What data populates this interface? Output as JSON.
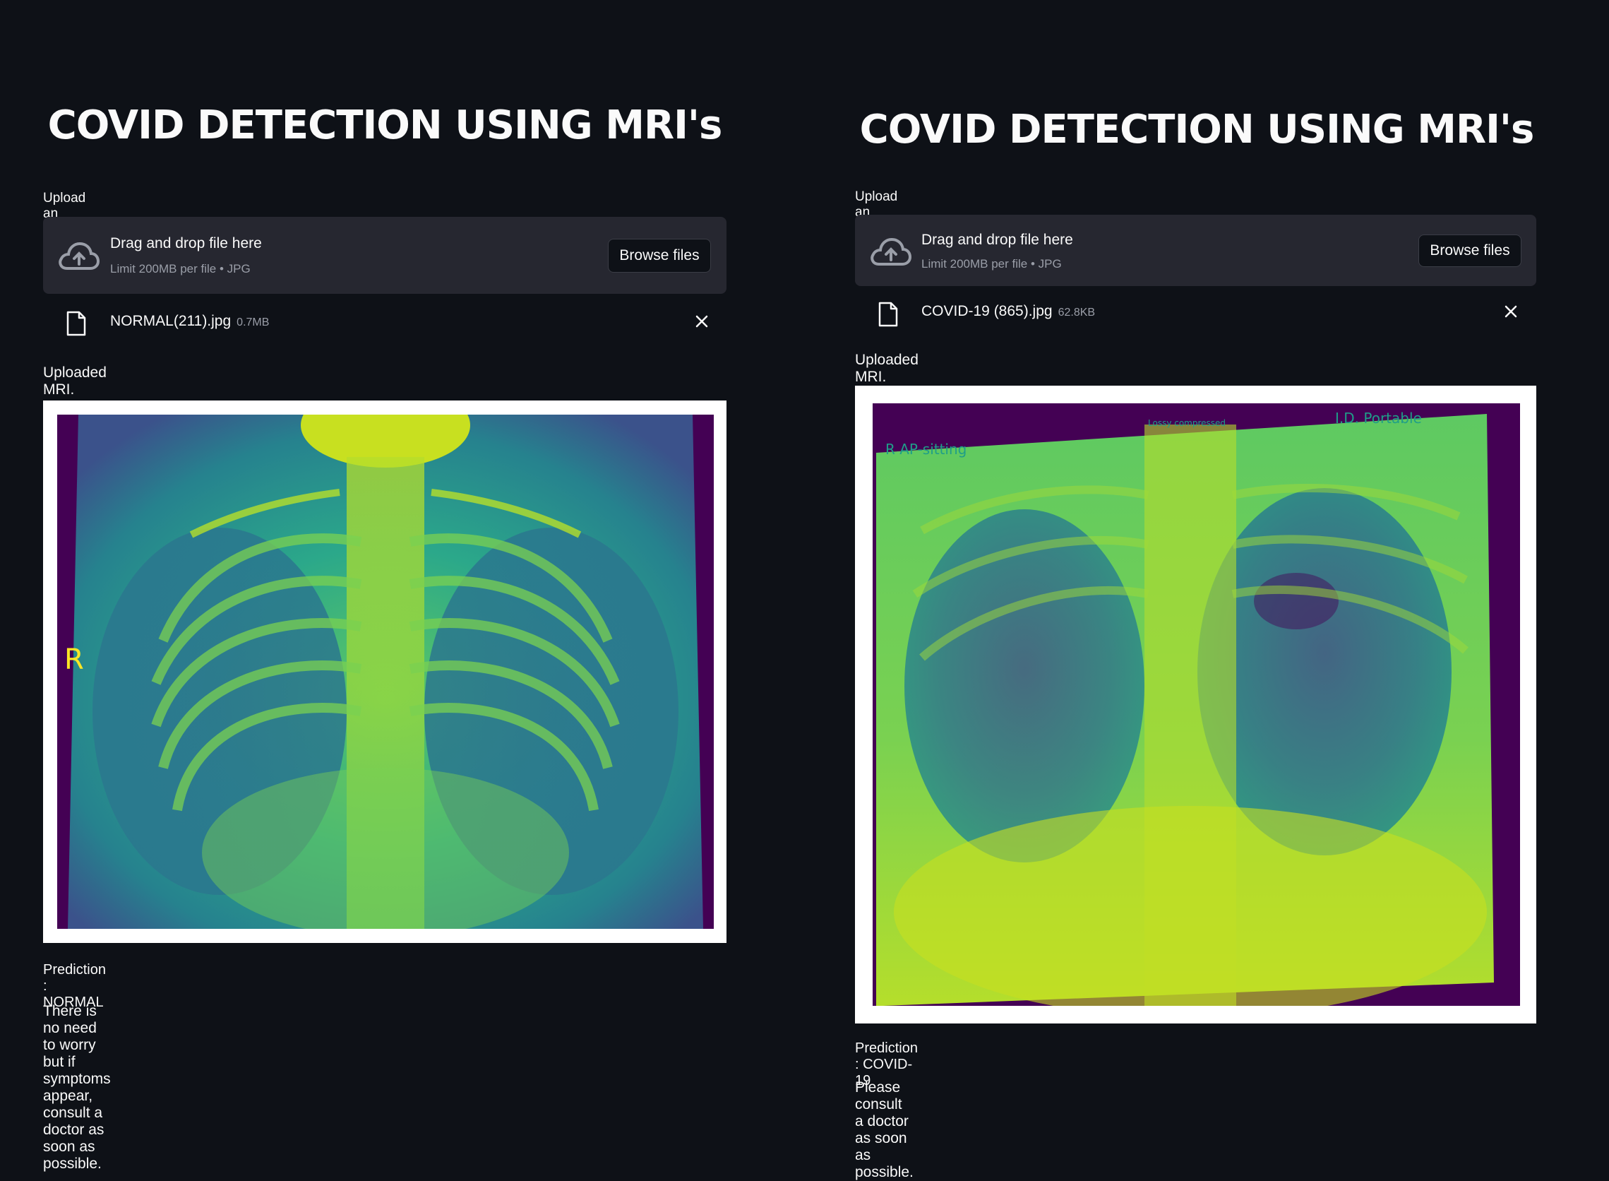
{
  "panels": [
    {
      "title": "COVID DETECTION USING MRI's",
      "upload_label": "Upload an image...",
      "dropzone": {
        "title": "Drag and drop file here",
        "subtitle": "Limit 200MB per file • JPG",
        "browse_label": "Browse files"
      },
      "file": {
        "name": "NORMAL(211).jpg",
        "size": "0.7MB"
      },
      "image_caption": "Uploaded MRI.",
      "image_marker": "R",
      "prediction": "Prediction : NORMAL",
      "message": "There is no need to worry but if symptoms appear, consult a doctor as soon as possible."
    },
    {
      "title": "COVID DETECTION USING MRI's",
      "upload_label": "Upload an image...",
      "dropzone": {
        "title": "Drag and drop file here",
        "subtitle": "Limit 200MB per file • JPG",
        "browse_label": "Browse files"
      },
      "file": {
        "name": "COVID-19 (865).jpg",
        "size": "62.8KB"
      },
      "image_caption": "Uploaded MRI.",
      "image_labels": {
        "left": "R AP-sitting",
        "center": "Lossy compressed",
        "right": "I.D. Portable"
      },
      "prediction": "Prediction : COVID-19",
      "message": "Please consult a doctor as soon as possible."
    }
  ],
  "colors": {
    "background": "#0e1117",
    "dropzone": "#262730",
    "text": "#fafafa",
    "muted": "#9a9ea8",
    "xray_dark": "#440154",
    "xray_mid": "#21918c",
    "xray_bright": "#bddf26"
  },
  "icons": {
    "upload": "cloud-upload-icon",
    "file": "file-icon",
    "remove": "close-icon"
  }
}
